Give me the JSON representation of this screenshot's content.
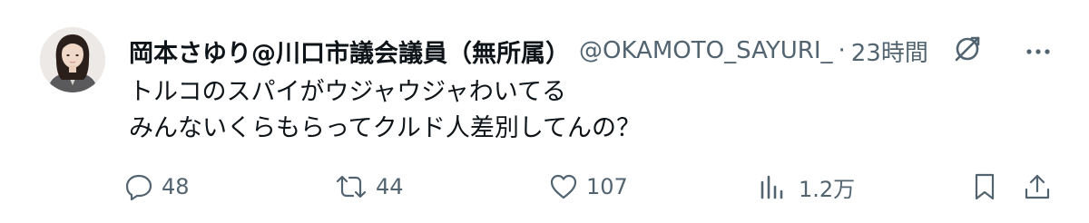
{
  "author": {
    "display_name": "岡本さゆり@川口市議会議員（無所属）",
    "handle": "@OKAMOTO_SAYURI_",
    "separator": "·",
    "time": "23時間"
  },
  "tweet": {
    "lines": [
      "トルコのスパイがウジャウジャわいてる",
      "みんないくらもらってクルド人差別してんの？"
    ]
  },
  "actions": {
    "reply_count": "48",
    "retweet_count": "44",
    "like_count": "107",
    "views_count": "1.2万"
  },
  "icons": {
    "reply": "reply-icon",
    "retweet": "retweet-icon",
    "like": "heart-icon",
    "views": "views-icon",
    "bookmark": "bookmark-icon",
    "share": "share-icon",
    "grok": "grok-icon",
    "more": "more-icon"
  },
  "colors": {
    "text_primary": "#0f1419",
    "text_secondary": "#536471",
    "background": "#ffffff"
  }
}
